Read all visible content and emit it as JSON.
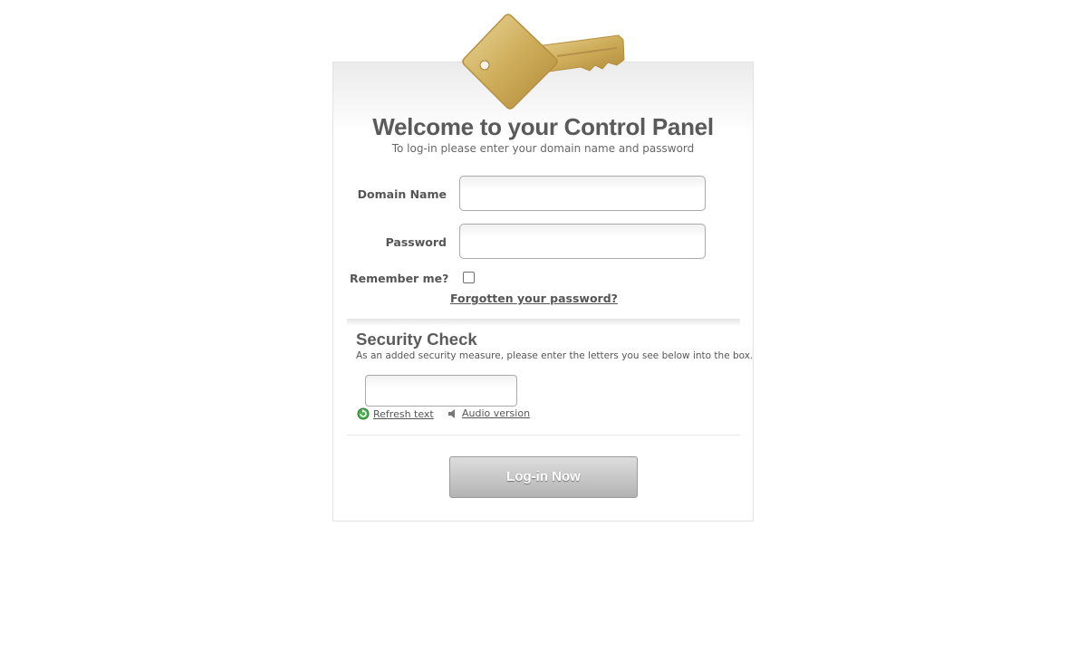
{
  "header": {
    "title": "Welcome to your Control Panel",
    "subtitle": "To log-in please enter your domain name and password",
    "logo_icon": "key-icon"
  },
  "form": {
    "domain_label": "Domain Name",
    "domain_value": "",
    "password_label": "Password",
    "password_value": "",
    "remember_label": "Remember me?",
    "remember_checked": false,
    "forgot_link": "Forgotten your password?"
  },
  "security": {
    "title": "Security Check",
    "description": "As an added security measure, please enter the letters you see below into the box.",
    "captcha_value": "",
    "refresh_label": "Refresh text",
    "refresh_icon": "refresh-icon",
    "audio_label": "Audio version",
    "audio_icon": "speaker-icon"
  },
  "actions": {
    "login_label": "Log-in Now"
  },
  "colors": {
    "key_gold": "#c9a84f",
    "text": "#555555",
    "button": "#bdbdbd"
  }
}
